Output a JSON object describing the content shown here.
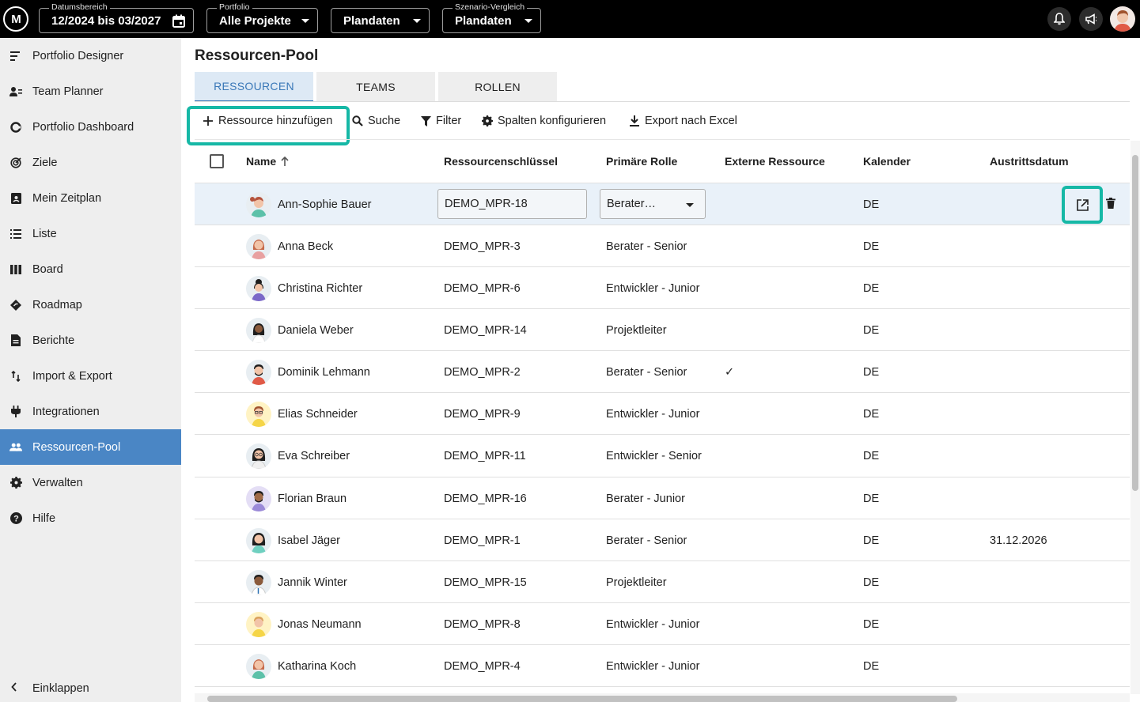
{
  "topbar": {
    "logo": "M",
    "date_range": {
      "label": "Datumsbereich",
      "value": "12/2024 bis 03/2027"
    },
    "portfolio": {
      "label": "Portfolio",
      "value": "Alle Projekte"
    },
    "data_source": {
      "value": "Plandaten"
    },
    "scenario": {
      "label": "Szenario-Vergleich",
      "value": "Plandaten"
    },
    "icons": [
      "bell-icon",
      "megaphone-icon",
      "user-avatar"
    ]
  },
  "sidebar": {
    "items": [
      {
        "label": "Portfolio Designer",
        "icon": "portfolio-designer-icon"
      },
      {
        "label": "Team Planner",
        "icon": "team-planner-icon"
      },
      {
        "label": "Portfolio Dashboard",
        "icon": "dashboard-icon"
      },
      {
        "label": "Ziele",
        "icon": "target-icon"
      },
      {
        "label": "Mein Zeitplan",
        "icon": "schedule-icon"
      },
      {
        "label": "Liste",
        "icon": "list-icon"
      },
      {
        "label": "Board",
        "icon": "board-icon"
      },
      {
        "label": "Roadmap",
        "icon": "roadmap-icon"
      },
      {
        "label": "Berichte",
        "icon": "report-icon"
      },
      {
        "label": "Import & Export",
        "icon": "import-export-icon"
      },
      {
        "label": "Integrationen",
        "icon": "plug-icon"
      },
      {
        "label": "Ressourcen-Pool",
        "icon": "people-icon",
        "active": true
      },
      {
        "label": "Verwalten",
        "icon": "gear-icon"
      },
      {
        "label": "Hilfe",
        "icon": "help-icon"
      }
    ],
    "collapse_label": "Einklappen"
  },
  "main": {
    "title": "Ressourcen-Pool",
    "tabs": [
      {
        "label": "RESSOURCEN",
        "active": true
      },
      {
        "label": "TEAMS"
      },
      {
        "label": "ROLLEN"
      }
    ],
    "toolbar": {
      "add": "Ressource hinzufügen",
      "search": "Suche",
      "filter": "Filter",
      "columns": "Spalten konfigurieren",
      "export": "Export nach Excel"
    },
    "table": {
      "headers": [
        "Name",
        "Ressourcenschlüssel",
        "Primäre Rolle",
        "Externe Ressource",
        "Kalender",
        "Austrittsdatum"
      ],
      "rows": [
        {
          "name": "Ann-Sophie Bauer",
          "key": "DEMO_MPR-18",
          "role": "Berater…",
          "external": "",
          "calendar": "DE",
          "exit": "",
          "editing": true
        },
        {
          "name": "Anna Beck",
          "key": "DEMO_MPR-3",
          "role": "Berater - Senior",
          "external": "",
          "calendar": "DE",
          "exit": ""
        },
        {
          "name": "Christina Richter",
          "key": "DEMO_MPR-6",
          "role": "Entwickler - Junior",
          "external": "",
          "calendar": "DE",
          "exit": ""
        },
        {
          "name": "Daniela Weber",
          "key": "DEMO_MPR-14",
          "role": "Projektleiter",
          "external": "",
          "calendar": "DE",
          "exit": ""
        },
        {
          "name": "Dominik Lehmann",
          "key": "DEMO_MPR-2",
          "role": "Berater - Senior",
          "external": "✓",
          "calendar": "DE",
          "exit": ""
        },
        {
          "name": "Elias Schneider",
          "key": "DEMO_MPR-9",
          "role": "Entwickler - Junior",
          "external": "",
          "calendar": "DE",
          "exit": ""
        },
        {
          "name": "Eva Schreiber",
          "key": "DEMO_MPR-11",
          "role": "Entwickler - Senior",
          "external": "",
          "calendar": "DE",
          "exit": ""
        },
        {
          "name": "Florian Braun",
          "key": "DEMO_MPR-16",
          "role": "Berater - Junior",
          "external": "",
          "calendar": "DE",
          "exit": ""
        },
        {
          "name": "Isabel Jäger",
          "key": "DEMO_MPR-1",
          "role": "Berater - Senior",
          "external": "",
          "calendar": "DE",
          "exit": "31.12.2026"
        },
        {
          "name": "Jannik Winter",
          "key": "DEMO_MPR-15",
          "role": "Projektleiter",
          "external": "",
          "calendar": "DE",
          "exit": ""
        },
        {
          "name": "Jonas Neumann",
          "key": "DEMO_MPR-8",
          "role": "Entwickler - Junior",
          "external": "",
          "calendar": "DE",
          "exit": ""
        },
        {
          "name": "Katharina Koch",
          "key": "DEMO_MPR-4",
          "role": "Entwickler - Junior",
          "external": "",
          "calendar": "DE",
          "exit": ""
        }
      ]
    }
  },
  "colors": {
    "topbar": "#000000",
    "sidebar": "#eeeeee",
    "active_nav": "#4a86c5",
    "highlight": "#16b8a6",
    "selected_row": "#e9f1f9"
  }
}
